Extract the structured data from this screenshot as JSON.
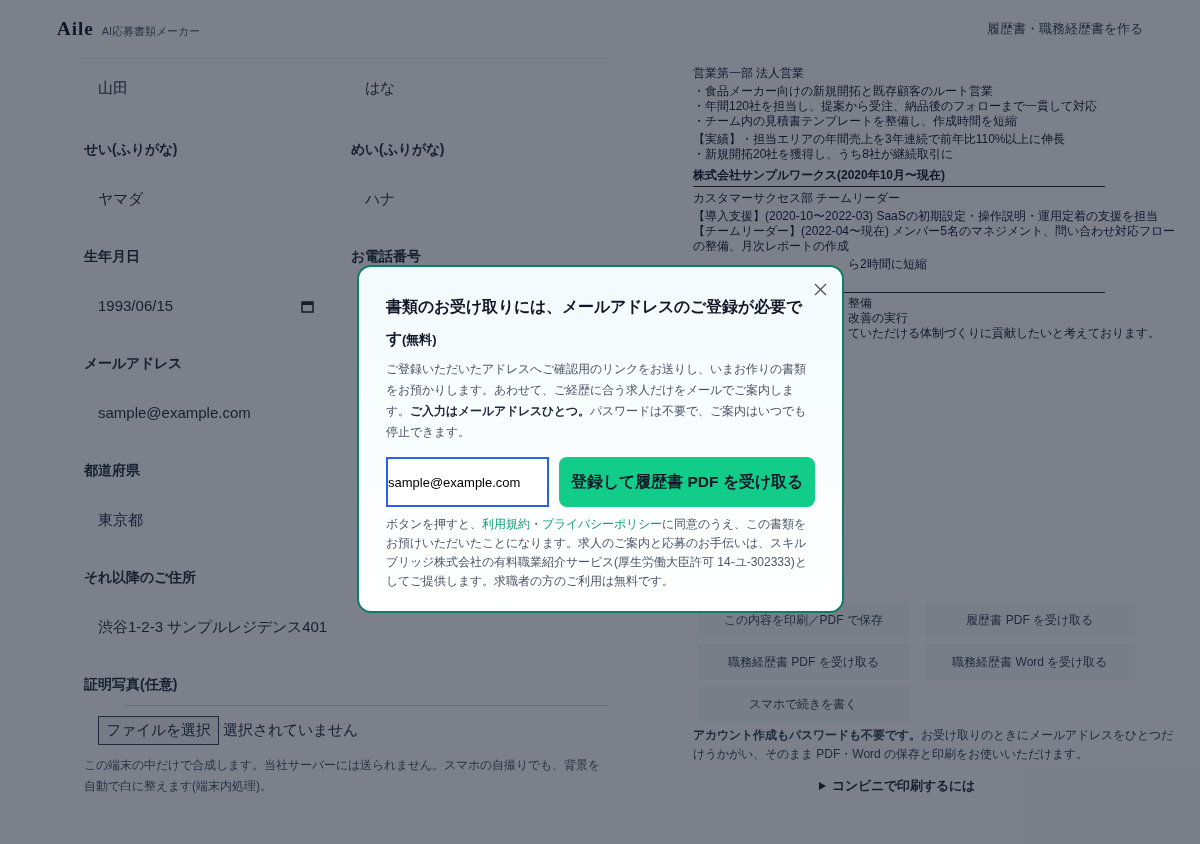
{
  "header": {
    "logo": "Aile",
    "tagline": "AI応募書類メーカー",
    "nav_link": "履歴書・職務経歴書を作る"
  },
  "form": {
    "rows": [
      [
        {
          "value": "山田",
          "kind": "text"
        },
        {
          "value": "はな",
          "kind": "text"
        }
      ],
      [
        {
          "label": "せい(ふりがな)",
          "value": "ヤマダ",
          "kind": "text"
        },
        {
          "label": "めい(ふりがな)",
          "value": "ハナ",
          "kind": "text"
        }
      ],
      [
        {
          "label": "生年月日",
          "value": "1993/06/15",
          "kind": "date"
        },
        {
          "label": "お電話番号"
        }
      ],
      [
        {
          "label": "メールアドレス",
          "value": "sample@example.com",
          "kind": "text"
        }
      ],
      [
        {
          "label": "都道府県",
          "value": "東京都",
          "kind": "text"
        }
      ],
      [
        {
          "label": "それ以降のご住所",
          "value": "渋谷1-2-3 サンプルレジデンス401",
          "kind": "text"
        }
      ]
    ],
    "photo": {
      "label": "証明写真(任意)",
      "file_button": "ファイルを選択",
      "file_status": "選択されていません",
      "hint": "この端末の中だけで合成します。当社サーバーには送られません。スマホの自撮りでも、背景を自動で白に整えます(端末内処理)。"
    }
  },
  "preview": {
    "items": [
      {
        "kind": "text",
        "text": "営業第一部 法人営業"
      },
      {
        "kind": "gap"
      },
      {
        "kind": "text",
        "text": "・食品メーカー向けの新規開拓と既存顧客のルート営業"
      },
      {
        "kind": "text",
        "text": "・年間120社を担当し、提案から受注、納品後のフォローまで一貫して対応"
      },
      {
        "kind": "text",
        "text": "・チーム内の見積書テンプレートを整備し、作成時間を短縮"
      },
      {
        "kind": "gap"
      },
      {
        "kind": "text",
        "text": "【実績】・担当エリアの年間売上を3年連続で前年比110%以上に伸長"
      },
      {
        "kind": "text",
        "text": "・新規開拓20社を獲得し、うち8社が継続取引に"
      },
      {
        "kind": "heading",
        "text": "株式会社サンプルワークス(2020年10月〜現在)"
      },
      {
        "kind": "text",
        "text": "カスタマーサクセス部 チームリーダー"
      },
      {
        "kind": "gap"
      },
      {
        "kind": "text",
        "text": "【導入支援】(2020-10〜2022-03) SaaSの初期設定・操作説明・運用定着の支援を担当"
      },
      {
        "kind": "text",
        "text": "【チームリーダー】(2022-04〜現在) メンバー5名のマネジメント、問い合わせ対応フローの整備、月次レポートの作成"
      },
      {
        "kind": "gap"
      },
      {
        "kind": "fragment",
        "text": "ら2時間に短縮"
      },
      {
        "kind": "rule"
      },
      {
        "kind": "gap"
      },
      {
        "kind": "fragment",
        "text": "整備"
      },
      {
        "kind": "fragment",
        "text": "改善の実行"
      },
      {
        "kind": "fragment",
        "text": "ていただける体制づくりに貢献したいと考えております。"
      }
    ],
    "buttons": [
      "この内容を印刷／PDF で保存",
      "履歴書 PDF を受け取る",
      "職務経歴書 PDF を受け取る",
      "職務経歴書 Word を受け取る",
      "スマホで続きを書く"
    ],
    "notice": "**アカウント作成もパスワードも不要です。**お受け取りのときにメールアドレスをひとつだけうかがい、そのまま PDF・Word の保存と印刷をお使いいただけます。",
    "details": {
      "summary": "コンビニで印刷するには",
      "expanded": false
    }
  },
  "modal": {
    "title": "書類のお受け取りには、メールアドレスのご登録が必要です",
    "title_note": "(無料)",
    "body": "ご登録いただいたアドレスへご確認用のリンクをお送りし、いまお作りの書類をお預かりします。あわせて、ご経歴に合う求人だけをメールでご案内します。**ご入力はメールアドレスひとつ。**パスワードは不要で、ご案内はいつでも停止できます。",
    "email_value": "sample@example.com",
    "submit": "登録して履歴書 PDF を受け取る",
    "legal": [
      {
        "text": "ボタンを押すと、",
        "link": false
      },
      {
        "text": "利用規約",
        "link": true
      },
      {
        "text": "・",
        "link": false
      },
      {
        "text": "プライバシーポリシー",
        "link": true
      },
      {
        "text": "に同意のうえ、この書類をお預けいただいたことになります。求人のご案内と応募のお手伝いは、スキルブリッジ株式会社の有料職業紹介サービス(厚生労働大臣許可 14-ユ-302333)としてご提供します。求職者の方のご利用は無料です。",
        "link": false
      }
    ]
  }
}
